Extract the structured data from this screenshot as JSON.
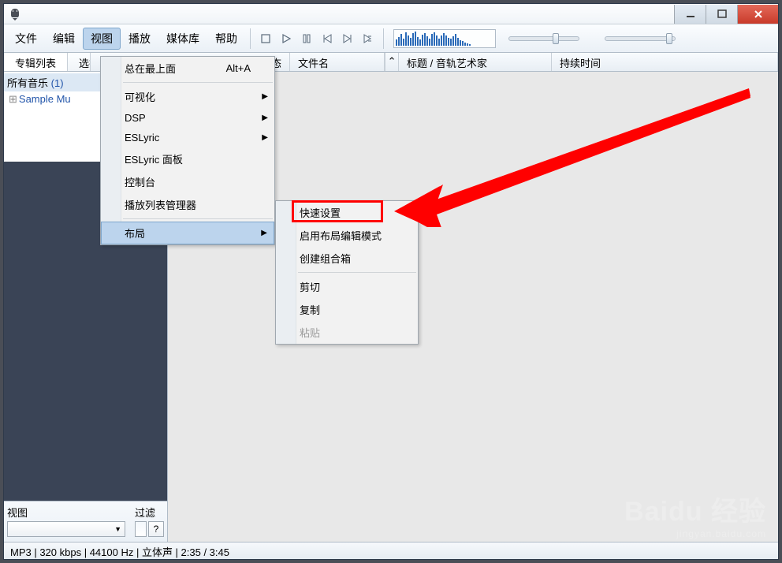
{
  "menubar": {
    "file": "文件",
    "edit": "编辑",
    "view": "视图",
    "playback": "播放",
    "library": "媒体库",
    "help": "帮助"
  },
  "tabs": {
    "album_list": "专辑列表",
    "select": "选择"
  },
  "columns": {
    "status": "态",
    "filename": "文件名",
    "title_artist": "标题 / 音轨艺术家",
    "duration": "持续时间"
  },
  "tree": {
    "all_music": "所有音乐",
    "all_music_count": "(1)",
    "sample": "Sample Mu"
  },
  "sidebar": {
    "view_label": "视图",
    "filter_label": "过滤",
    "filter_help": "?"
  },
  "view_menu": {
    "always_on_top": "总在最上面",
    "always_on_top_shortcut": "Alt+A",
    "visualizations": "可视化",
    "dsp": "DSP",
    "eslyric": "ESLyric",
    "eslyric_panel": "ESLyric 面板",
    "console": "控制台",
    "playlist_manager": "播放列表管理器",
    "layout": "布局"
  },
  "layout_submenu": {
    "quick_setup": "快速设置",
    "enable_edit": "启用布局编辑模式",
    "create_group": "创建组合箱",
    "cut": "剪切",
    "copy": "复制",
    "paste": "粘贴"
  },
  "statusbar": "MP3 | 320 kbps | 44100 Hz | 立体声 | 2:35 / 3:45",
  "watermark": {
    "brand": "Baidu 经验",
    "url": "jingyan.baidu.com"
  }
}
